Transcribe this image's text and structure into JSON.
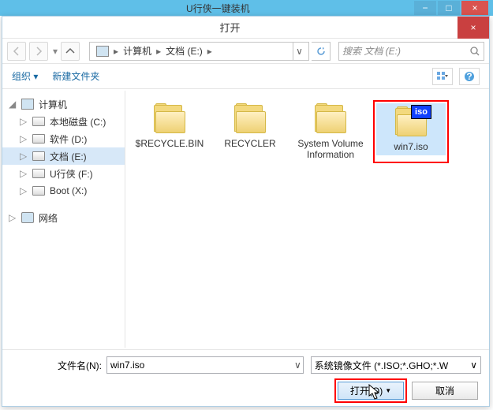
{
  "bg": {
    "title": "U行侠一键装机",
    "min": "−",
    "max": "□",
    "close": "×"
  },
  "dialog": {
    "title": "打开",
    "close_label": "×"
  },
  "nav": {
    "back": "←",
    "forward": "→",
    "up": "↑",
    "breadcrumb": {
      "root": "计算机",
      "sep": "▸",
      "current": "文档 (E:)"
    },
    "refresh": "↻",
    "search_placeholder": "搜索 文档 (E:)"
  },
  "toolbar": {
    "organize": "组织 ▾",
    "new_folder": "新建文件夹"
  },
  "sidebar": {
    "computer": "计算机",
    "drives": [
      {
        "label": "本地磁盘 (C:)"
      },
      {
        "label": "软件 (D:)"
      },
      {
        "label": "文档 (E:)"
      },
      {
        "label": "U行侠 (F:)"
      },
      {
        "label": "Boot (X:)"
      }
    ],
    "network": "网络"
  },
  "files": [
    {
      "name": "$RECYCLE.BIN",
      "type": "folder"
    },
    {
      "name": "RECYCLER",
      "type": "folder"
    },
    {
      "name": "System Volume Information",
      "type": "folder"
    },
    {
      "name": "win7.iso",
      "type": "iso",
      "selected": true
    }
  ],
  "bottom": {
    "filename_label": "文件名(N):",
    "filename_value": "win7.iso",
    "filetype": "系统镜像文件 (*.ISO;*.GHO;*.W",
    "open": "打开(O)",
    "cancel": "取消"
  },
  "icons": {
    "iso_badge": "iso",
    "dropdown": "▾",
    "search": "🔍",
    "help": "?"
  }
}
